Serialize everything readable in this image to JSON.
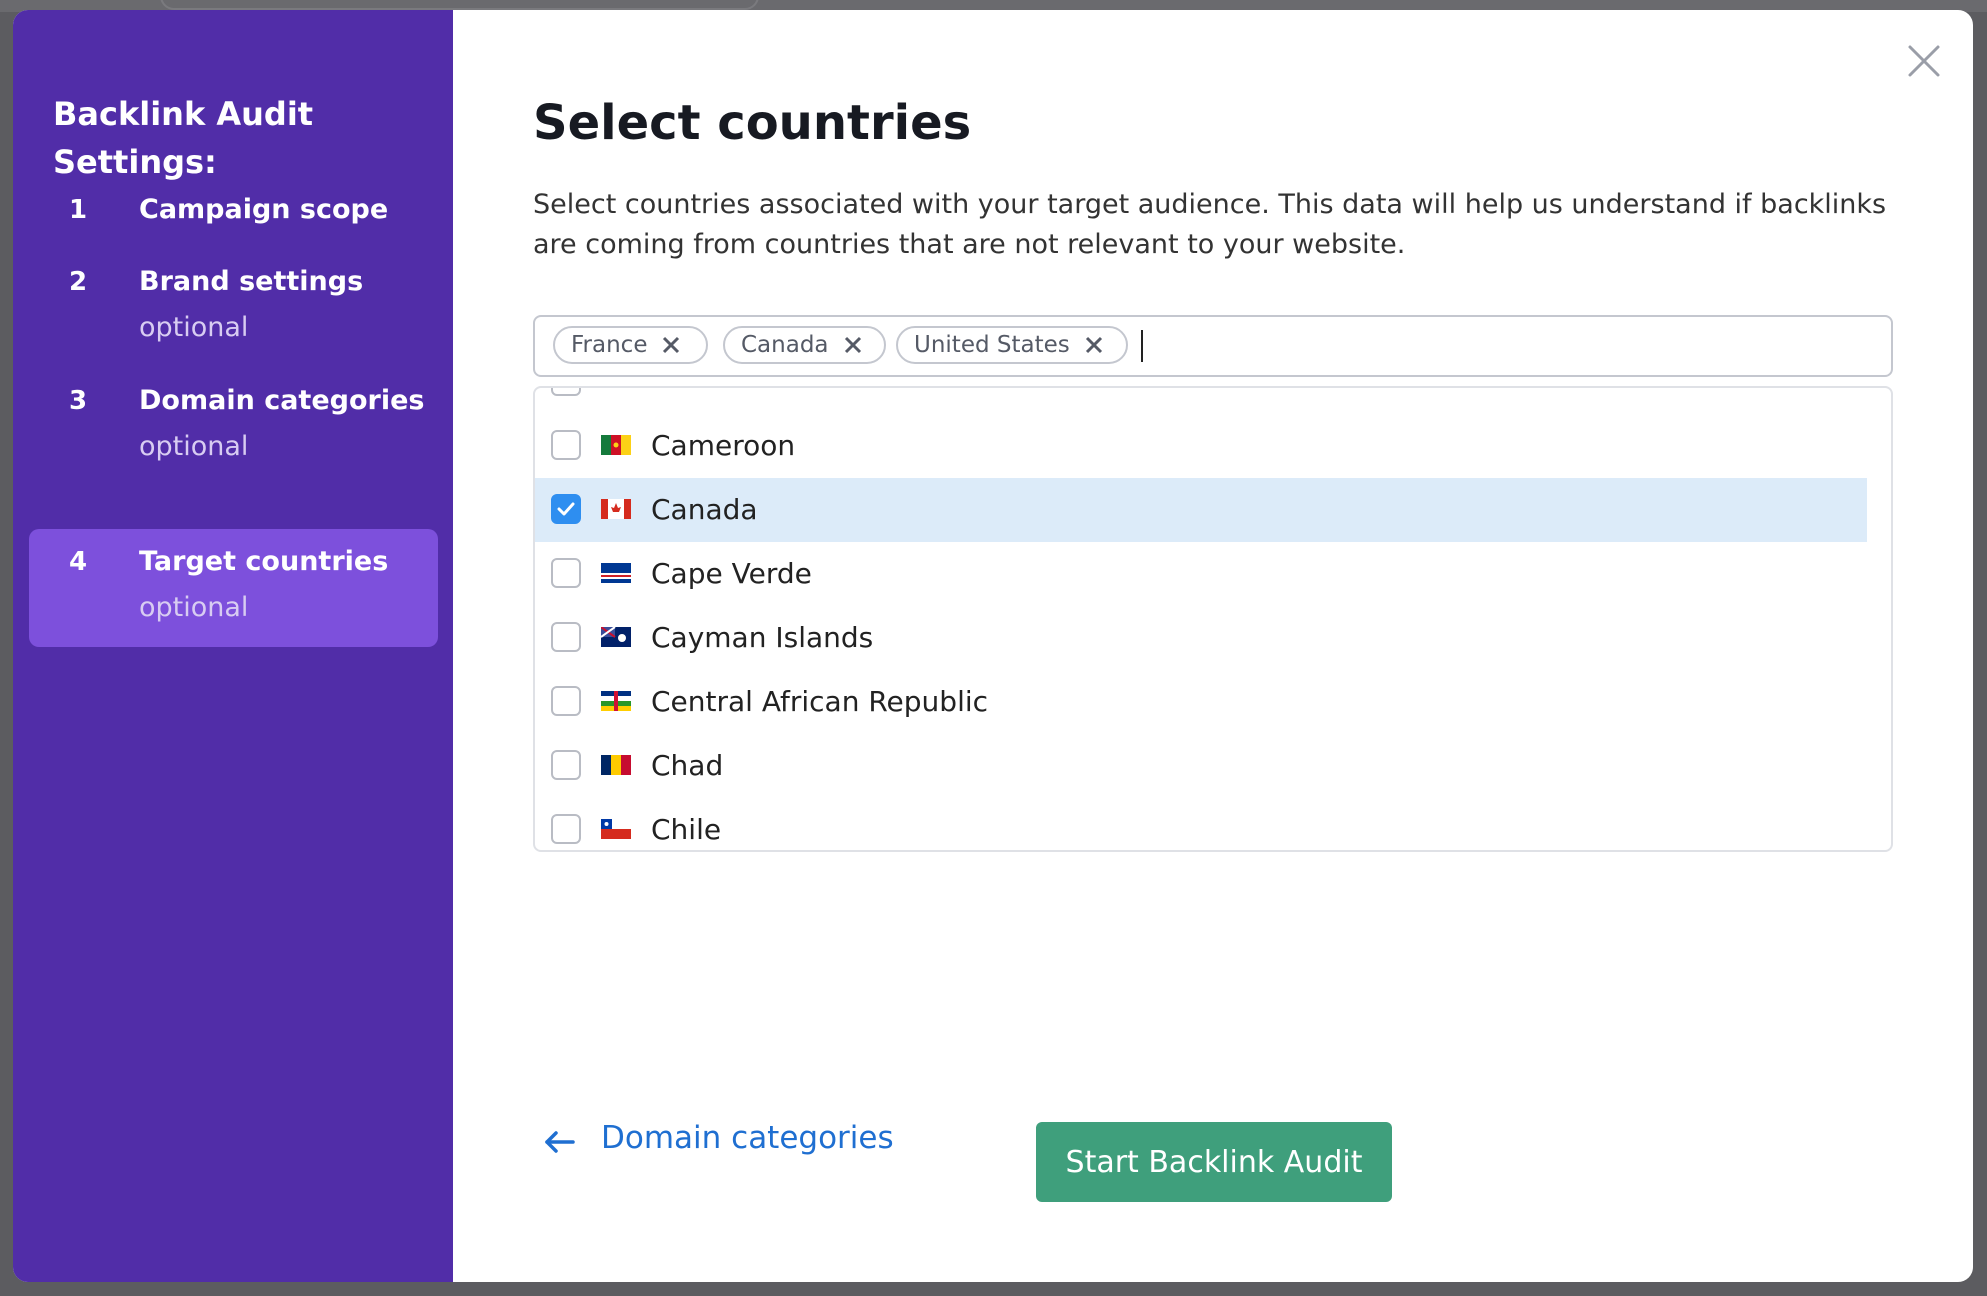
{
  "sidebar": {
    "title": "Backlink Audit Settings:",
    "steps": [
      {
        "num": "1",
        "label": "Campaign scope",
        "sub": ""
      },
      {
        "num": "2",
        "label": "Brand settings",
        "sub": "optional"
      },
      {
        "num": "3",
        "label": "Domain categories",
        "sub": "optional"
      },
      {
        "num": "4",
        "label": "Target countries",
        "sub": "optional",
        "active": true
      }
    ]
  },
  "main": {
    "title": "Select countries",
    "description": "Select countries associated with your target audience. This data will help us understand if backlinks are coming from countries that are not relevant to your website.",
    "selected_chips": [
      "France",
      "Canada",
      "United States"
    ],
    "options": [
      {
        "label": "Cameroon",
        "checked": false,
        "flag": "flag-cameroon"
      },
      {
        "label": "Canada",
        "checked": true,
        "flag": "flag-canada"
      },
      {
        "label": "Cape Verde",
        "checked": false,
        "flag": "flag-cape-verde"
      },
      {
        "label": "Cayman Islands",
        "checked": false,
        "flag": "flag-cayman-islands"
      },
      {
        "label": "Central African Republic",
        "checked": false,
        "flag": "flag-central-african-republic"
      },
      {
        "label": "Chad",
        "checked": false,
        "flag": "flag-chad"
      },
      {
        "label": "Chile",
        "checked": false,
        "flag": "flag-chile"
      }
    ]
  },
  "footer": {
    "back_label": "Domain categories",
    "start_label": "Start Backlink Audit"
  },
  "colors": {
    "sidebar_bg": "#512da8",
    "active_step_bg": "#7d50dc",
    "primary_button": "#3f9f7c",
    "link": "#1f6fd1",
    "checkbox_checked": "#2e8ef0",
    "selected_row": "#dcebf9"
  },
  "icons": [
    "close-icon",
    "chip-remove-icon",
    "checkmark-icon",
    "arrow-left-icon"
  ]
}
